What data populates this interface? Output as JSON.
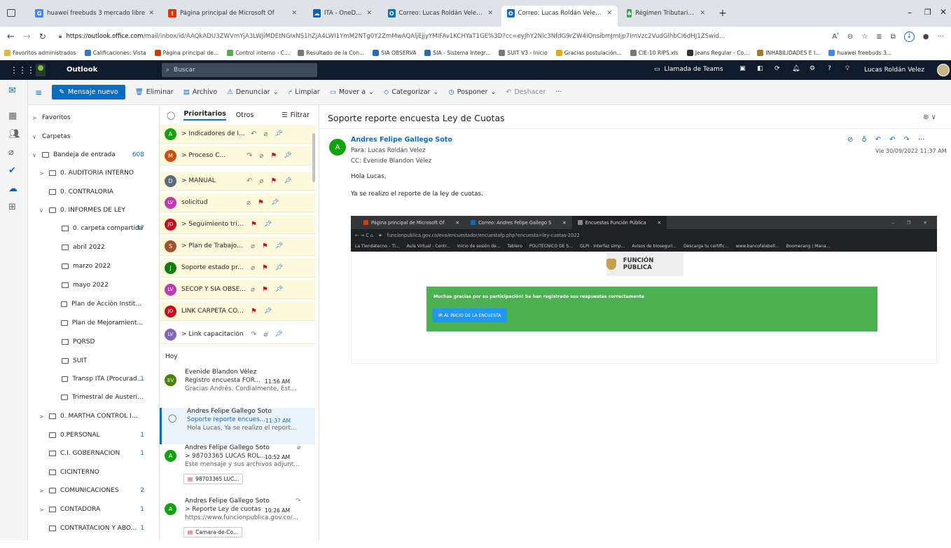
{
  "browser": {
    "tabs": [
      {
        "label": "huawei freebuds 3 mercado libre",
        "fav": "G",
        "color": "#4285f4"
      },
      {
        "label": "Página principal de Microsoft Of",
        "fav": "!",
        "color": "#d83b01"
      },
      {
        "label": "ITA - OneDrive",
        "fav": "☁",
        "color": "#0364b8"
      },
      {
        "label": "Correo: Lucas Roldán Velez - Out",
        "fav": "O",
        "color": "#0f6cbd"
      },
      {
        "label": "Correo: Lucas Roldán Velez - Out",
        "fav": "O",
        "color": "#0f6cbd"
      },
      {
        "label": "Régimen Tributario Especial – ESA",
        "fav": "♣",
        "color": "#3aa655"
      }
    ],
    "new_tab": "+",
    "url_domain": "https://outlook.office.com",
    "url_path": "/mail/inbox/id/AAQkADU3ZWVmYjA3LWJiMDEtNGIxNS1hZjA4LWI1YmM2NTg0Y2ZmMwAQAljEjjyYMIFAv1KCHYaT1GE%3D?cc=eyJhY2Nlc3NfdG9rZW4iOnsibmJmIjp7ImVzc2VudGlhbCI6dHJ1ZSwid...",
    "read_aloud": "Aʹ",
    "bookmarks": [
      {
        "label": "Favoritos administrados",
        "icon": "folder-icon"
      },
      {
        "label": "Calificaciones: Vista",
        "icon": "app-icon"
      },
      {
        "label": "Página principal de...",
        "icon": "office-icon"
      },
      {
        "label": "Control interno - C...",
        "icon": "leaf-icon"
      },
      {
        "label": "Resultado de la Con...",
        "icon": "doc-icon"
      },
      {
        "label": "SIA OBSERVA",
        "icon": "sia-icon"
      },
      {
        "label": "SIA - Sistema Integr...",
        "icon": "sia-icon"
      },
      {
        "label": "SUIT V3 - Inicio",
        "icon": "doc-icon"
      },
      {
        "label": "Gracias postulación...",
        "icon": "chat-icon"
      },
      {
        "label": "CIE-10 RIPS.xls",
        "icon": "doc-icon"
      },
      {
        "label": "Jeans Regular - Co...",
        "icon": "shop-icon"
      },
      {
        "label": "INHABILIDADES E I...",
        "icon": "seal-icon"
      },
      {
        "label": "huawei freebuds 3...",
        "icon": "google-icon"
      }
    ]
  },
  "outlook": {
    "app_name": "Outlook",
    "search_placeholder": "Buscar",
    "teams_call": "Llamada de Teams",
    "user_name": "Lucas Roldán Velez",
    "help": "?",
    "commands": {
      "new_message": "Mensaje nuevo",
      "delete": "Eliminar",
      "archive": "Archivo",
      "report": "Denunciar",
      "sweep": "Limpiar",
      "move": "Mover a",
      "categorize": "Categorizar",
      "snooze": "Posponer",
      "undo": "Deshacer",
      "more": "···"
    },
    "folders": [
      {
        "label": "Favoritos",
        "chev": ">",
        "depth": 0,
        "icon": false,
        "count": ""
      },
      {
        "label": "Carpetas",
        "chev": "∨",
        "depth": 0,
        "icon": false,
        "count": ""
      },
      {
        "label": "Bandeja de entrada",
        "chev": "∨",
        "depth": 1,
        "icon": true,
        "count": "608"
      },
      {
        "label": "0. AUDITORIA INTERNO",
        "chev": ">",
        "depth": 2,
        "icon": true,
        "count": ""
      },
      {
        "label": "0. CONTRALORIA",
        "chev": "",
        "depth": 2,
        "icon": true,
        "count": ""
      },
      {
        "label": "0. INFORMES DE LEY",
        "chev": "∨",
        "depth": 2,
        "icon": true,
        "count": ""
      },
      {
        "label": "0. carpeta compartida",
        "chev": "",
        "depth": 3,
        "icon": true,
        "count": "37"
      },
      {
        "label": "abril 2022",
        "chev": "",
        "depth": 3,
        "icon": true,
        "count": ""
      },
      {
        "label": "marzo 2022",
        "chev": "",
        "depth": 3,
        "icon": true,
        "count": ""
      },
      {
        "label": "mayo 2022",
        "chev": "",
        "depth": 3,
        "icon": true,
        "count": ""
      },
      {
        "label": "Plan de Acción Institucio...",
        "chev": "",
        "depth": 3,
        "icon": true,
        "count": ""
      },
      {
        "label": "Plan de Mejoramiento I...",
        "chev": "",
        "depth": 3,
        "icon": true,
        "count": ""
      },
      {
        "label": "PQRSD",
        "chev": "",
        "depth": 3,
        "icon": true,
        "count": ""
      },
      {
        "label": "SUIT",
        "chev": "",
        "depth": 3,
        "icon": true,
        "count": ""
      },
      {
        "label": "Transp ITA (Procuradu...",
        "chev": "",
        "depth": 3,
        "icon": true,
        "count": "1"
      },
      {
        "label": "Trimestral de Austerida...",
        "chev": "",
        "depth": 3,
        "icon": true,
        "count": ""
      },
      {
        "label": "0. MARTHA CONTROL IN...",
        "chev": ">",
        "depth": 2,
        "icon": true,
        "count": ""
      },
      {
        "label": "0.PERSONAL",
        "chev": "",
        "depth": 2,
        "icon": true,
        "count": "1"
      },
      {
        "label": "C.I. GOBERNACION",
        "chev": "",
        "depth": 2,
        "icon": true,
        "count": "1"
      },
      {
        "label": "CICINTERNO",
        "chev": "",
        "depth": 2,
        "icon": true,
        "count": ""
      },
      {
        "label": "COMUNICACIONES",
        "chev": ">",
        "depth": 2,
        "icon": true,
        "count": "2"
      },
      {
        "label": "CONTADORA",
        "chev": ">",
        "depth": 2,
        "icon": true,
        "count": "1"
      },
      {
        "label": "CONTRATACION Y ABO...",
        "chev": "",
        "depth": 2,
        "icon": true,
        "count": "1"
      }
    ],
    "list_tabs": {
      "focused": "Prioritarios",
      "other": "Otros",
      "filter": "Filtrar"
    },
    "pinned": [
      {
        "initials": "A",
        "color": "#13a10e",
        "subject": "> Indicadores de I...",
        "reply": "↶",
        "clip": true,
        "flag": false
      },
      {
        "initials": "M",
        "color": "#ca5010",
        "subject": "> Proceso C...",
        "reply": "↷",
        "clip": true,
        "flag": true
      },
      {
        "initials": "D",
        "color": "#5c6b7a",
        "subject": "> MANUAL",
        "reply": "↶",
        "clip": true,
        "flag": true
      },
      {
        "initials": "LV",
        "color": "#c239b3",
        "subject": "solicitud",
        "reply": "",
        "clip": true,
        "flag": true
      },
      {
        "initials": "JD",
        "color": "#c50f1f",
        "subject": "> Seguimiento trimestr...",
        "reply": "",
        "clip": false,
        "flag": true
      },
      {
        "initials": "S",
        "color": "#a0522d",
        "subject": "> Plan de Trabajo...",
        "reply": "",
        "clip": true,
        "flag": true
      },
      {
        "initials": "J",
        "color": "#107c10",
        "subject": "Soporte estado pr...",
        "reply": "",
        "clip": true,
        "flag": true
      },
      {
        "initials": "LV",
        "color": "#c239b3",
        "subject": "SECOP Y SIA OBSE...",
        "reply": "",
        "clip": true,
        "flag": true
      },
      {
        "initials": "JD",
        "color": "#c50f1f",
        "subject": "LINK CARPETA COMPAR...",
        "reply": "",
        "clip": false,
        "flag": true
      },
      {
        "initials": "LV",
        "color": "#8764b8",
        "subject": "> Link capacitación",
        "reply": "↷",
        "clip": true,
        "flag": false
      }
    ],
    "today_header": "Hoy",
    "messages": [
      {
        "initials": "EV",
        "color": "#498205",
        "sender": "Evenide Blandon Vélez",
        "subject": "Registro encuesta FOR...",
        "time": "11:56 AM",
        "preview": "Gracias Andrés. Cordialmente, Est...",
        "attachment": ""
      },
      {
        "initials": "",
        "color": "",
        "sender": "Andres Felipe Gallego Soto",
        "subject": "Soporte reporte encues...",
        "time": "11:37 AM",
        "preview": "Hola Lucas, Ya se realizo el report...",
        "attachment": ""
      },
      {
        "initials": "A",
        "color": "#13a10e",
        "sender": "Andres Felipe Gallego Soto",
        "subject": "> 98703365 LUCAS ROL...",
        "time": "10:52 AM",
        "preview": "Este mensaje y sus archivos adjunt...",
        "attachment": "98703365 LUC..."
      },
      {
        "initials": "A",
        "color": "#13a10e",
        "sender": "Andres Felipe Gallego Soto",
        "subject": "> Reporte Ley de cuotas",
        "time": "10:26 AM",
        "preview": "https://www.funcionpublica.gov.co/...",
        "attachment": "Camara-de-Co..."
      }
    ],
    "reading": {
      "subject": "Soporte reporte encuesta Ley de Cuotas",
      "sender_initial": "A",
      "sender": "Andres Felipe Gallego Soto",
      "to": "Para: Lucas Roldán Velez",
      "cc": "CC: Evenide Blandon Vélez",
      "date": "Vie 30/09/2022 11:37 AM",
      "greeting": "Hola Lucas,",
      "body": "Ya se realizo el reporte de la ley de cuotas.",
      "zoom_icon": "⊕ ∨"
    },
    "embedded": {
      "tabs": [
        "Página principal de Microsoft Of",
        "Correo: Andres Felipe Gallego S",
        "Encuestas Función Pública"
      ],
      "url": "funcionpublica.gov.co/eva/encuestador/encuestafp.php?encuesta=ley-cuotas-2022",
      "bookmarks": [
        "La Tiendatecno – Ti...",
        "Aula Virtual - Centr...",
        "Inicio de sesión de...",
        "Tablero",
        "POLITÉCNICO DE S...",
        "GLPI - Interfaz simp...",
        "Avisos de bioseguri...",
        "Descarga tu certific...",
        "www.bancofalabell...",
        "Boomerang | Mana..."
      ],
      "brand": "FUNCIÓN PÚBLICA",
      "thanks": "Muchas gracias por su participación! Se han registrado sus respuestas correctamente",
      "button": "IR AL INICIO DE LA ENCUESTA",
      "green": "#4caf50",
      "blue": "#2196f3"
    }
  }
}
